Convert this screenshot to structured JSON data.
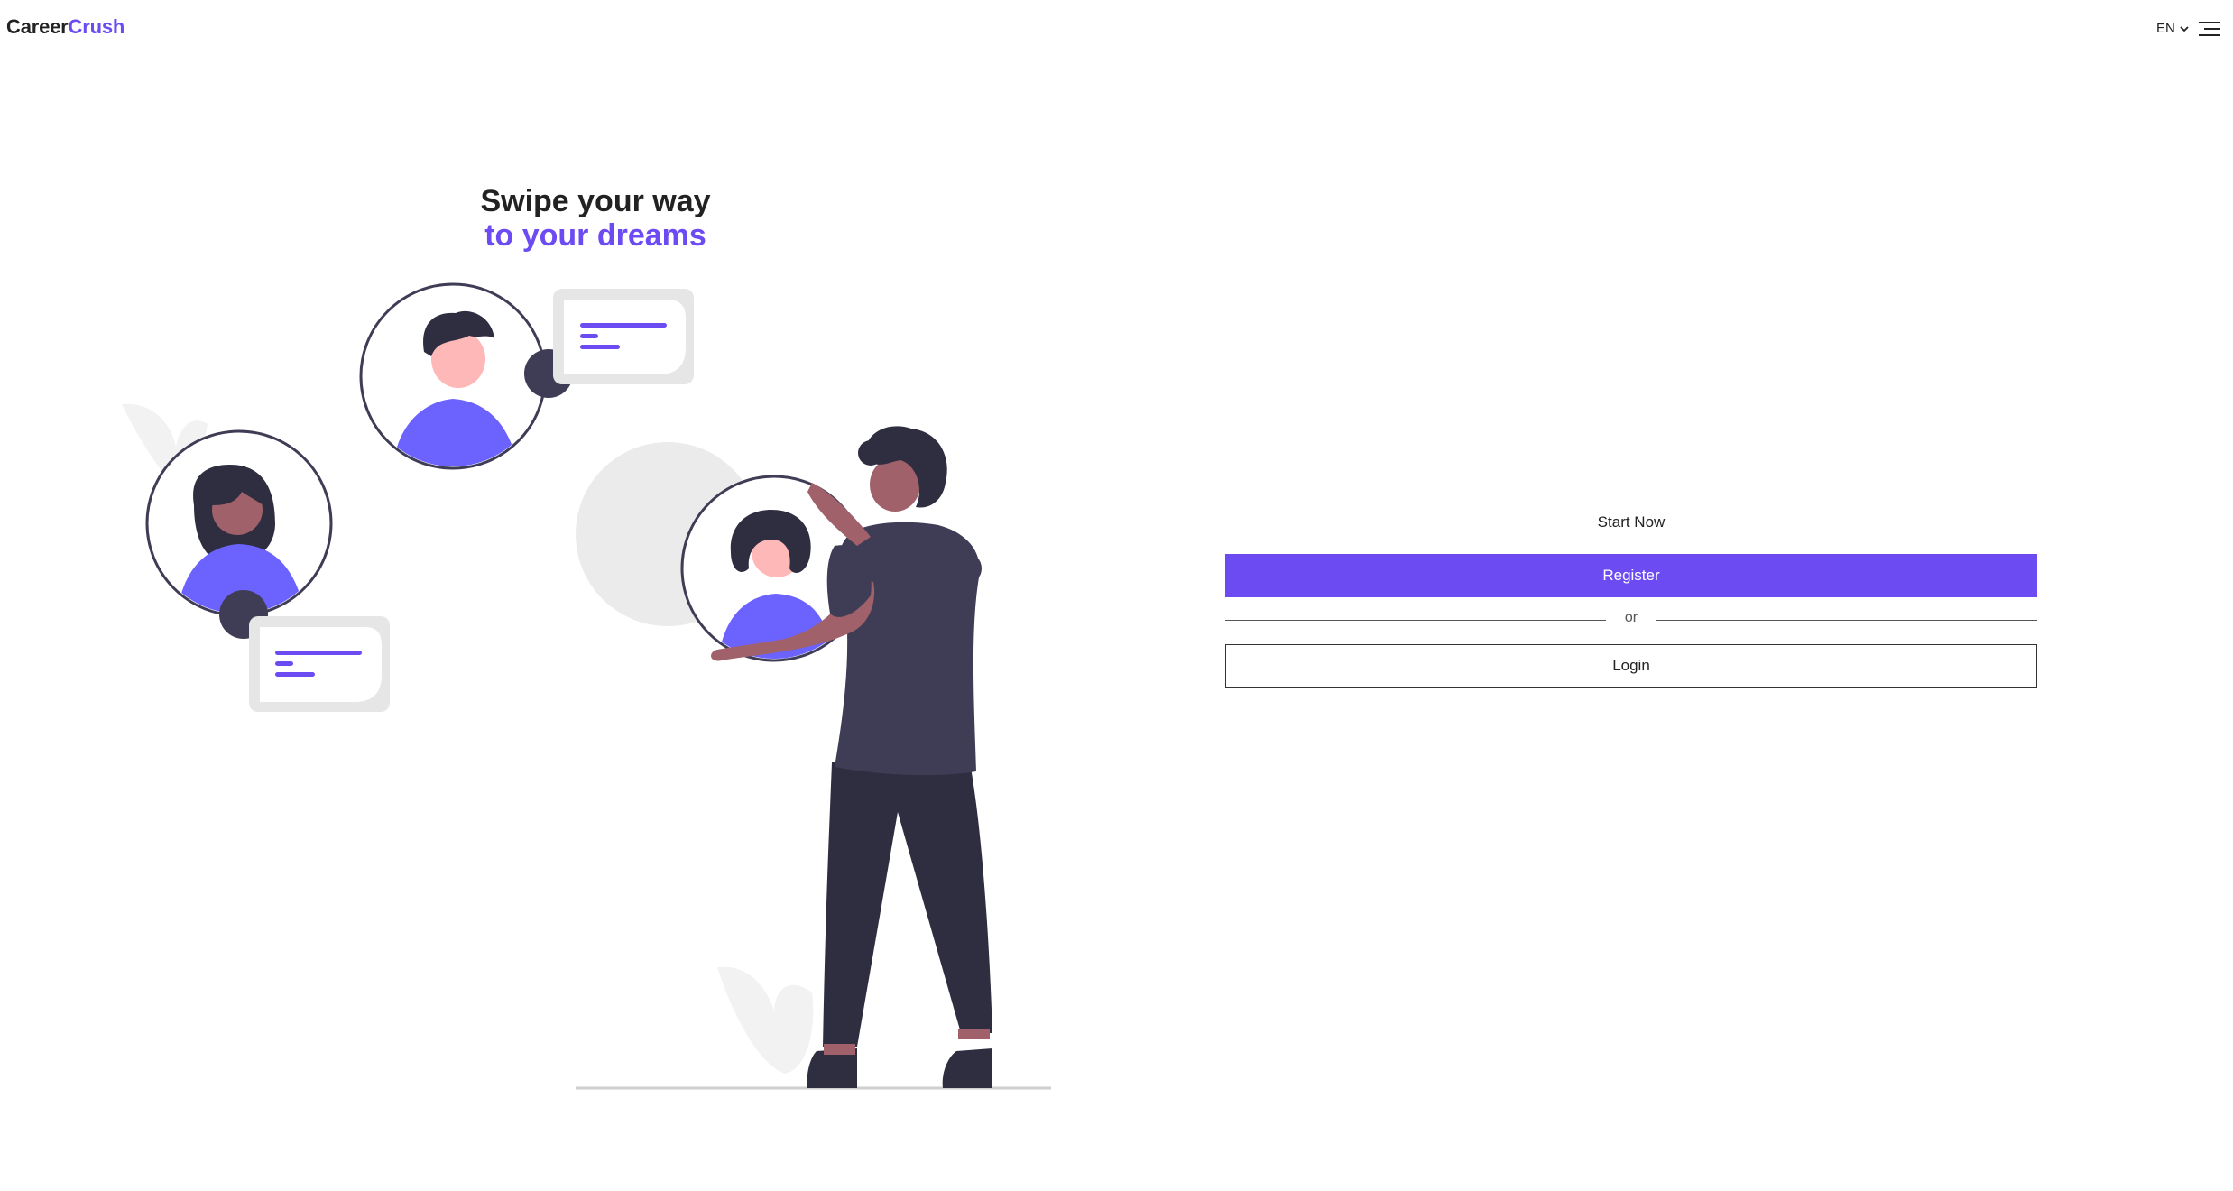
{
  "header": {
    "logo_part1": "Career",
    "logo_part2": "Crush",
    "language": "EN",
    "menu_icon": "hamburger-menu-icon"
  },
  "hero": {
    "title_line1": "Swipe your way",
    "title_line2": "to your dreams"
  },
  "panel": {
    "heading": "Start Now",
    "register_label": "Register",
    "divider_text": "or",
    "login_label": "Login"
  },
  "colors": {
    "accent": "#6c4cf2",
    "dark": "#2f2e41",
    "skin_light": "#ffb8b8",
    "skin_dark": "#a0616a",
    "light_gray": "#e6e6e6"
  }
}
